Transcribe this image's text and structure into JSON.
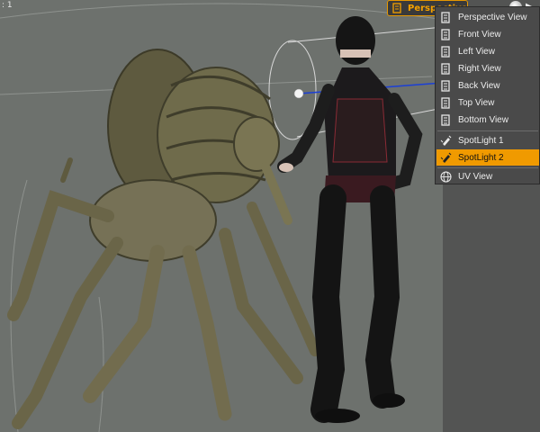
{
  "viewport": {
    "corner_label": ": 1",
    "camera_button_label": "Perspective View",
    "sphere_icon": "render-sphere-icon",
    "arrow_icon": "triangle-right-icon"
  },
  "menu": {
    "items": [
      {
        "label": "Perspective View",
        "icon": "camera-icon"
      },
      {
        "label": "Front View",
        "icon": "camera-icon"
      },
      {
        "label": "Left View",
        "icon": "camera-icon"
      },
      {
        "label": "Right View",
        "icon": "camera-icon"
      },
      {
        "label": "Back View",
        "icon": "camera-icon"
      },
      {
        "label": "Top View",
        "icon": "camera-icon"
      },
      {
        "label": "Bottom View",
        "icon": "camera-icon"
      },
      {
        "label": "SpotLight 1",
        "icon": "spotlight-icon"
      },
      {
        "label": "SpotLight 2",
        "icon": "spotlight-icon",
        "selected": true
      },
      {
        "label": "UV View",
        "icon": "globe-icon"
      }
    ]
  },
  "colors": {
    "accent": "#f09a00",
    "menu_bg": "#4a4a4a",
    "viewport_bg": "#6d716d",
    "panel_bg": "#535453"
  }
}
